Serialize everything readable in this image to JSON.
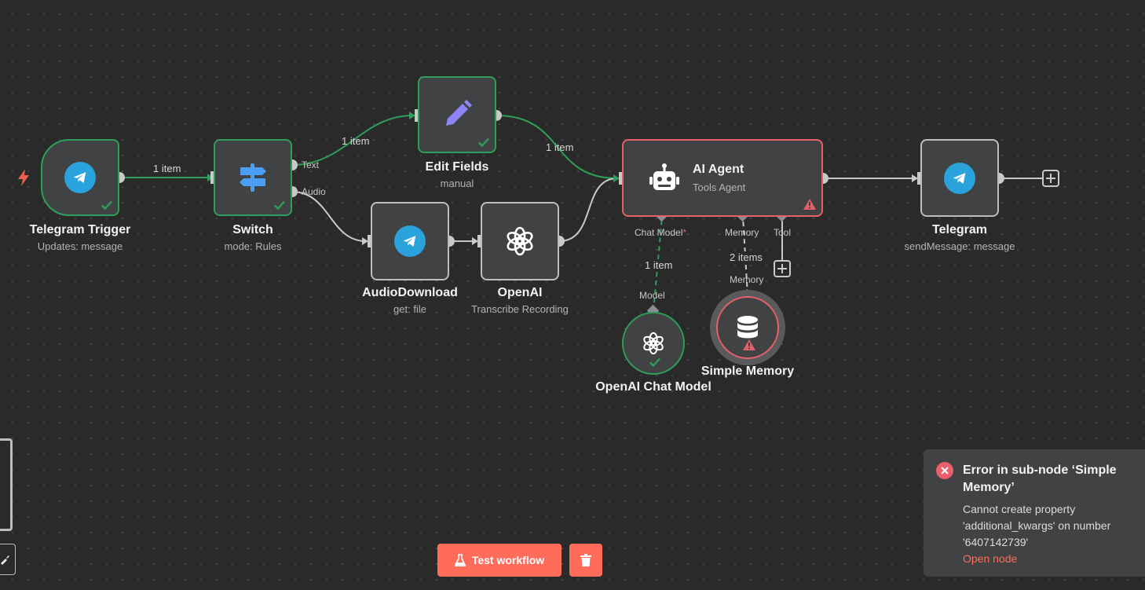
{
  "nodes": {
    "telegram_trigger": {
      "title": "Telegram Trigger",
      "subtitle": "Updates: message"
    },
    "switch": {
      "title": "Switch",
      "subtitle": "mode: Rules",
      "outputs": [
        "Text",
        "Audio"
      ]
    },
    "edit_fields": {
      "title": "Edit Fields",
      "subtitle": "manual"
    },
    "audio_download": {
      "title": "AudioDownload",
      "subtitle": "get: file"
    },
    "openai": {
      "title": "OpenAI",
      "subtitle": "Transcribe Recording"
    },
    "ai_agent": {
      "title": "AI Agent",
      "subtitle": "Tools Agent",
      "inputs": {
        "chat_model": "Chat Model",
        "required_mark": "*",
        "memory": "Memory",
        "tool": "Tool"
      }
    },
    "telegram": {
      "title": "Telegram",
      "subtitle": "sendMessage: message"
    },
    "openai_chat_model": {
      "title": "OpenAI Chat Model",
      "port": "Model"
    },
    "simple_memory": {
      "title": "Simple Memory",
      "port": "Memory"
    }
  },
  "edges": {
    "trigger_to_switch": "1 item",
    "switch_to_edit": "1 item",
    "edit_to_agent": "1 item",
    "model_to_agent": "1 item",
    "memory_to_agent": "2 items"
  },
  "toolbar": {
    "test_label": "Test workflow"
  },
  "toast": {
    "title": "Error in sub-node ‘Simple Memory’",
    "message": "Cannot create property 'additional_kwargs' on number '6407142739'",
    "link": "Open node"
  },
  "colors": {
    "success": "#2f9e59",
    "error": "#e6606a",
    "accent": "#ff6d5a",
    "telegram": "#2aa3dc",
    "switch_icon": "#4a9ff5",
    "edit_icon": "#8e86f5"
  },
  "icons": [
    "bolt-icon",
    "telegram-icon",
    "signpost-icon",
    "pencil-icon",
    "openai-icon",
    "robot-icon",
    "database-icon",
    "warning-icon",
    "check-icon",
    "plus-icon",
    "flask-icon",
    "trash-icon",
    "close-icon"
  ]
}
